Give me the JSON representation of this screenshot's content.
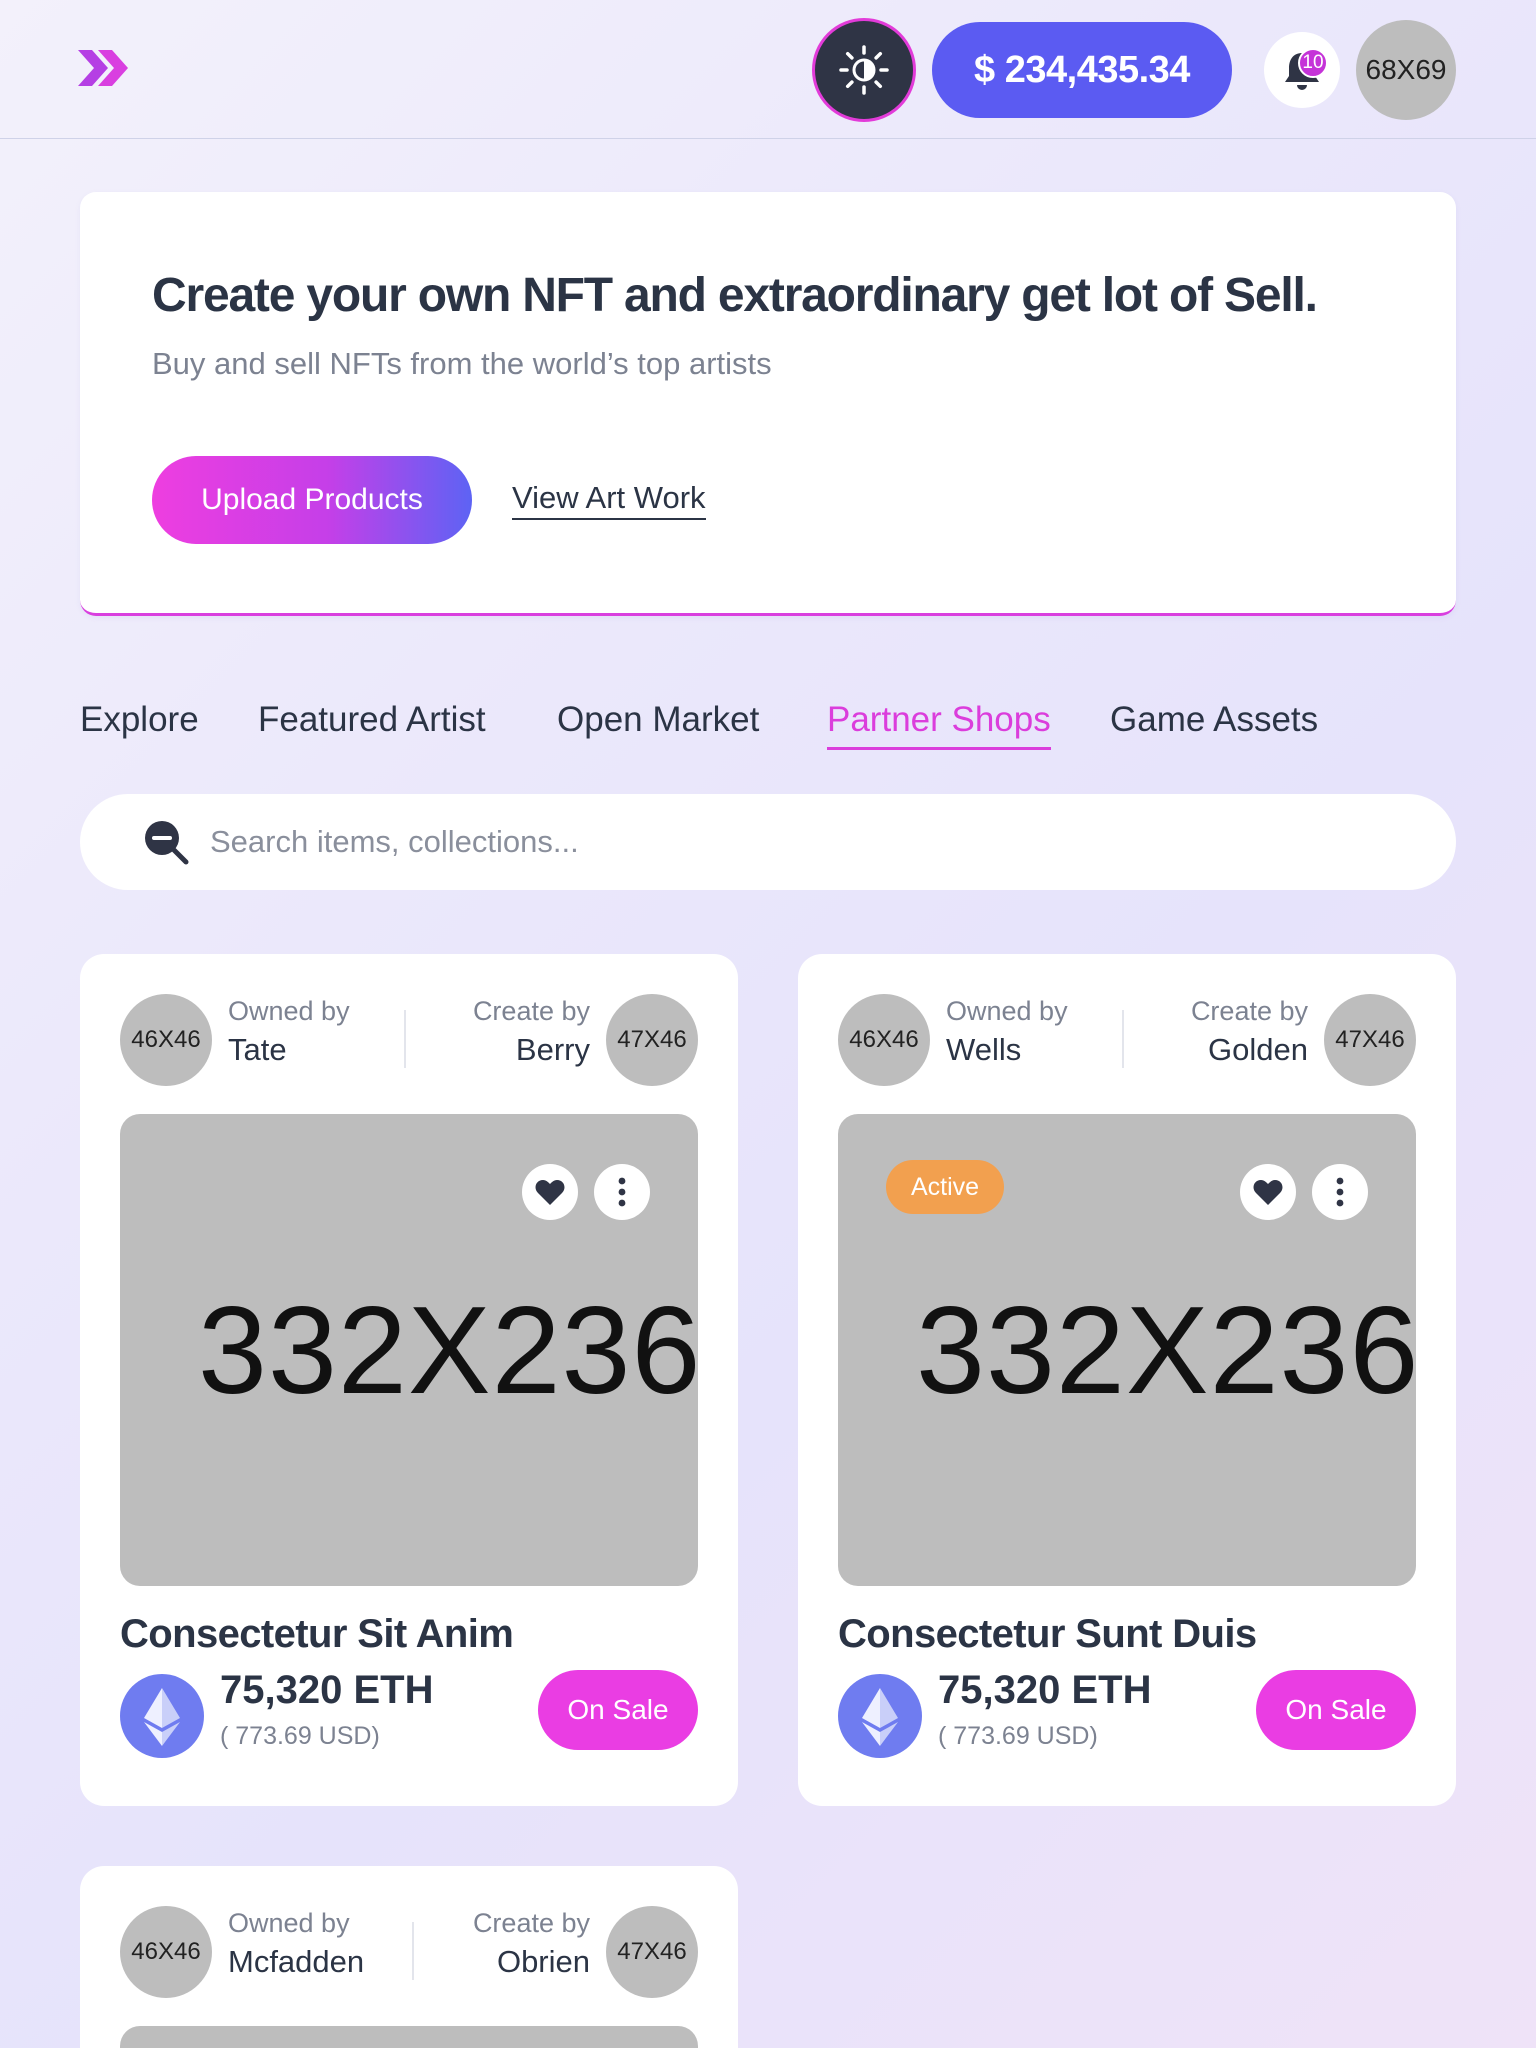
{
  "header": {
    "logo_icon": "double-chevron-right-icon",
    "theme_icon": "sun-icon",
    "balance": "$ 234,435.34",
    "notification_icon": "bell-icon",
    "notification_count": "10",
    "avatar_label": "68X69"
  },
  "hero": {
    "title": "Create your own NFT and extraordinary get lot of Sell.",
    "subtitle": "Buy and sell NFTs from the world’s top artists",
    "upload_label": "Upload Products",
    "view_label": "View Art Work"
  },
  "tabs": [
    {
      "label": "Explore",
      "active": false
    },
    {
      "label": "Featured Artist",
      "active": false
    },
    {
      "label": "Open Market",
      "active": false
    },
    {
      "label": "Partner Shops",
      "active": true
    },
    {
      "label": "Game Assets",
      "active": false
    }
  ],
  "search": {
    "placeholder": "Search items, collections..."
  },
  "cards": [
    {
      "owner_avatar": "46X46",
      "owned_label": "Owned by",
      "owner": "Tate",
      "creator_label": "Create by",
      "creator": "Berry",
      "creator_avatar": "47X46",
      "image_label": "332X236",
      "title": "Consectetur Sit Anim",
      "price": "75,320 ETH",
      "usd": "( 773.69 USD)",
      "sale_label": "On Sale"
    },
    {
      "owner_avatar": "46X46",
      "owned_label": "Owned by",
      "owner": "Wells",
      "creator_label": "Create by",
      "creator": "Golden",
      "creator_avatar": "47X46",
      "badge": "Active",
      "image_label": "332X236",
      "title": "Consectetur Sunt Duis",
      "price": "75,320 ETH",
      "usd": "( 773.69 USD)",
      "sale_label": "On Sale"
    },
    {
      "owner_avatar": "46X46",
      "owned_label": "Owned by",
      "owner": "Mcfadden",
      "creator_label": "Create by",
      "creator": "Obrien",
      "creator_avatar": "47X46"
    }
  ],
  "colors": {
    "accent_pink": "#ea3de3",
    "accent_blue": "#5b5bf2",
    "badge_orange": "#f2a04f",
    "text_dark": "#2b3445"
  }
}
